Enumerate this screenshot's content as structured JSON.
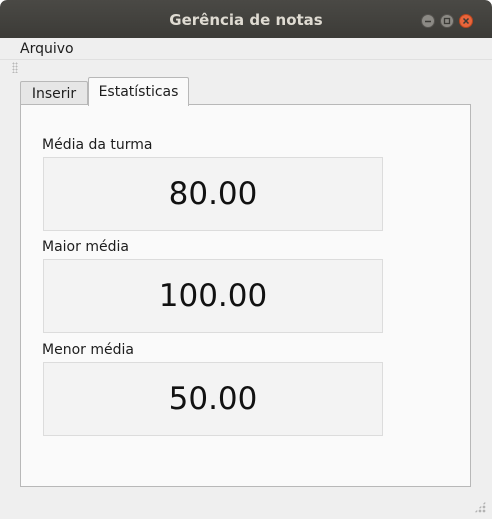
{
  "window": {
    "title": "Gerência de notas",
    "controls": {
      "minimize": "minimize-icon",
      "maximize": "maximize-icon",
      "close": "close-icon"
    }
  },
  "menubar": {
    "items": [
      {
        "label": "Arquivo"
      }
    ]
  },
  "tabs": [
    {
      "label": "Inserir",
      "active": false
    },
    {
      "label": "Estatísticas",
      "active": true
    }
  ],
  "stats": {
    "average": {
      "label": "Média da turma",
      "value": "80.00"
    },
    "max": {
      "label": "Maior média",
      "value": "100.00"
    },
    "min": {
      "label": "Menor média",
      "value": "50.00"
    }
  },
  "colors": {
    "titlebar": "#3c3b37",
    "close_button": "#e9653b",
    "panel": "#fafafa"
  }
}
